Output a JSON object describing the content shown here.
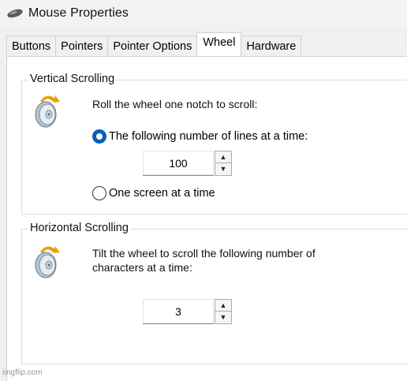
{
  "window": {
    "title": "Mouse Properties"
  },
  "tabs": [
    {
      "label": "Buttons",
      "active": false
    },
    {
      "label": "Pointers",
      "active": false
    },
    {
      "label": "Pointer Options",
      "active": false
    },
    {
      "label": "Wheel",
      "active": true
    },
    {
      "label": "Hardware",
      "active": false
    }
  ],
  "vertical": {
    "legend": "Vertical Scrolling",
    "prompt": "Roll the wheel one notch to scroll:",
    "option_lines": "The following number of lines at a time:",
    "lines_value": "100",
    "option_screen": "One screen at a time",
    "selected_option": "lines"
  },
  "horizontal": {
    "legend": "Horizontal Scrolling",
    "prompt_line1": "Tilt the wheel to scroll the following number of",
    "prompt_line2": "characters at a time:",
    "chars_value": "3"
  },
  "spinner": {
    "up_glyph": "▲",
    "down_glyph": "▼"
  },
  "icons": {
    "app": "mouse-icon",
    "vertical": "mouse-wheel-vertical-icon",
    "horizontal": "mouse-wheel-horizontal-icon"
  },
  "colors": {
    "accent": "#0a5fb4",
    "panel": "#ffffff",
    "window": "#f0f0f0"
  },
  "watermark": "imgflip.com"
}
